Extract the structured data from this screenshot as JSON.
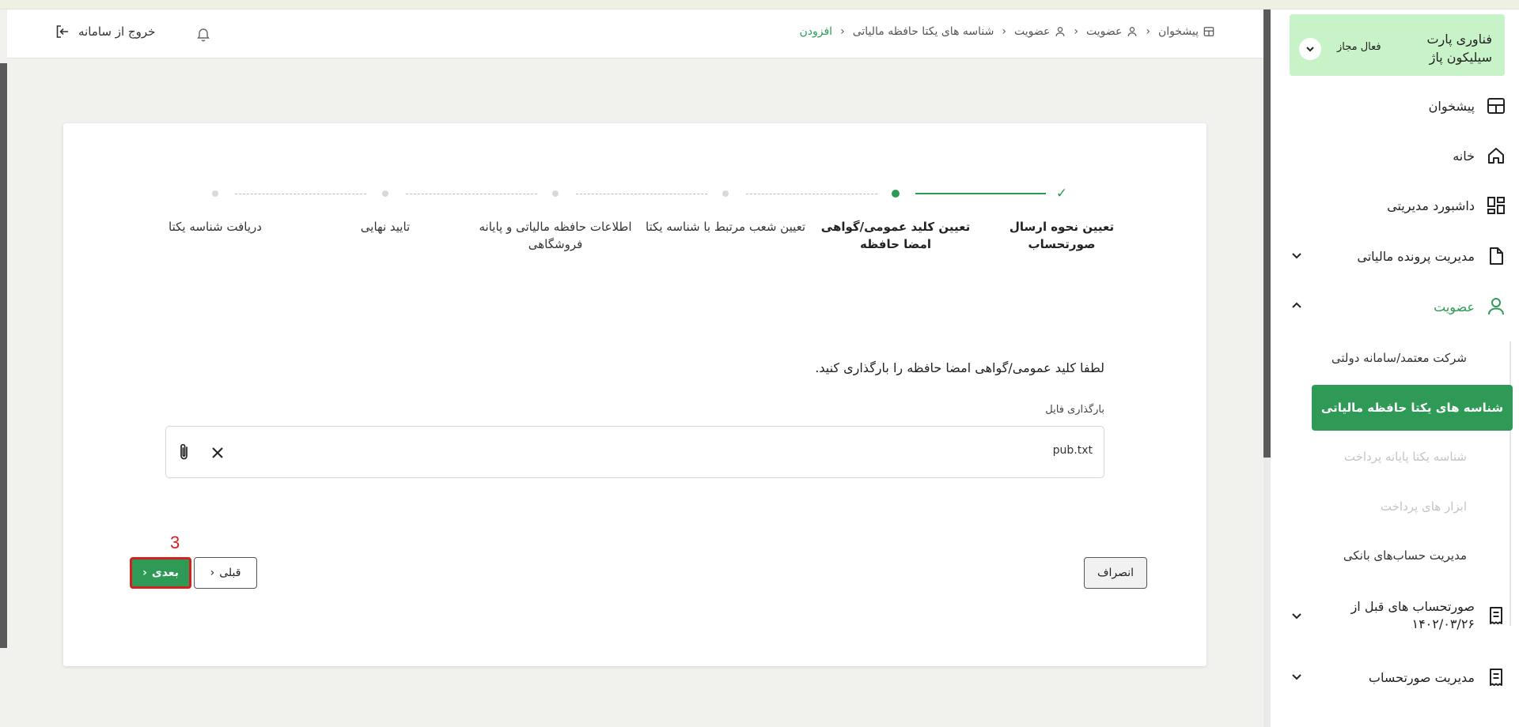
{
  "breadcrumb": [
    {
      "label": "پیشخوان",
      "icon": "dashboard-icon"
    },
    {
      "label": "عضویت",
      "icon": "user-icon"
    },
    {
      "label": "عضویت",
      "icon": "user-icon"
    },
    {
      "label": "شناسه های یکتا حافظه مالیاتی",
      "icon": ""
    },
    {
      "label": "افزودن",
      "icon": ""
    }
  ],
  "header": {
    "logout_label": "خروج از سامانه"
  },
  "stepper": {
    "steps": [
      {
        "label": "تعیین نحوه ارسال صورتحساب",
        "state": "done"
      },
      {
        "label": "تعیین کلید عمومی/گواهی امضا حافظه",
        "state": "current"
      },
      {
        "label": "تعیین شعب مرتبط با شناسه یکتا",
        "state": "pending"
      },
      {
        "label": "اطلاعات حافظه مالیاتی و پایانه فروشگاهی",
        "state": "pending"
      },
      {
        "label": "تایید نهایی",
        "state": "pending"
      },
      {
        "label": "دریافت شناسه یکتا",
        "state": "pending"
      }
    ]
  },
  "form": {
    "instruction": "لطفا کلید عمومی/گواهی امضا حافظه را بارگذاری کنید.",
    "file_label": "بارگذاری فایل",
    "file_name": "pub.txt"
  },
  "actions": {
    "cancel_label": "انصراف",
    "prev_label": "قبلی",
    "next_label": "بعدی",
    "step_number": "3"
  },
  "sidebar": {
    "company_name": "فناوری پارت سیلیکون پاژ",
    "company_status": "فعال مجاز",
    "items": [
      {
        "label": "پیشخوان",
        "icon": "dashboard-icon"
      },
      {
        "label": "خانه",
        "icon": "home-icon"
      },
      {
        "label": "داشبورد مدیریتی",
        "icon": "grid-icon"
      },
      {
        "label": "مدیریت پرونده مالیاتی",
        "icon": "file-icon"
      },
      {
        "label": "عضویت",
        "icon": "user-icon"
      },
      {
        "label": "صورتحساب های قبل از ۱۴۰۲/۰۳/۲۶",
        "icon": "receipt-icon"
      },
      {
        "label": "مدیریت صورتحساب",
        "icon": "receipt-icon"
      }
    ],
    "sub_items": [
      {
        "label": "شرکت معتمد/سامانه دولتی"
      },
      {
        "label": "شناسه های یکتا حافظه مالیاتی"
      },
      {
        "label": "شناسه یکتا پایانه پرداخت"
      },
      {
        "label": "ابزار های پرداخت"
      },
      {
        "label": "مدیریت حساب‌های بانکی"
      }
    ]
  },
  "colors": {
    "accent": "#2e9a55",
    "highlight": "#d32020",
    "company_bg": "#c8f2c8"
  }
}
